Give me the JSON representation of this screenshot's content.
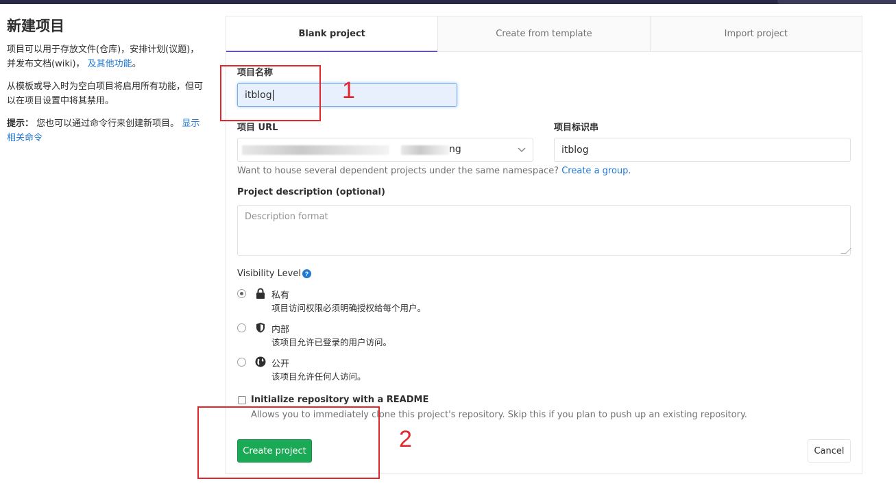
{
  "left": {
    "title": "新建项目",
    "desc": "项目可以用于存放文件(仓库)，安排计划(议题)，并发布文档(wiki)，",
    "desc_link": "及其他功能",
    "desc_end": "。",
    "template_note": "从模板或导入时为空白项目将启用所有功能，但可以在项目设置中将其禁用。",
    "tip_label": "提示：",
    "tip_text": "您也可以通过命令行来创建新项目。",
    "tip_link": "显示相关命令"
  },
  "tabs": [
    "Blank project",
    "Create from template",
    "Import project"
  ],
  "form": {
    "name_label": "项目名称",
    "name_value": "itblog",
    "url_label": "项目 URL",
    "namespace_partial": "ng",
    "slug_label": "项目标识串",
    "slug_value": "itblog",
    "group_help": "Want to house several dependent projects under the same namespace?",
    "group_link": "Create a group.",
    "desc_label": "Project description (optional)",
    "desc_placeholder": "Description format",
    "visibility_label": "Visibility Level",
    "visibility": [
      {
        "title": "私有",
        "desc": "项目访问权限必须明确授权给每个用户。",
        "icon": "lock-icon",
        "selected": true
      },
      {
        "title": "内部",
        "desc": "该项目允许已登录的用户访问。",
        "icon": "shield-icon",
        "selected": false
      },
      {
        "title": "公开",
        "desc": "该项目允许任何人访问。",
        "icon": "globe-icon",
        "selected": false
      }
    ],
    "readme_label": "Initialize repository with a README",
    "readme_help": "Allows you to immediately clone this project's repository. Skip this if you plan to push up an existing repository.",
    "create_button": "Create project",
    "cancel_button": "Cancel"
  },
  "annotations": [
    "1",
    "2"
  ],
  "colors": {
    "accent": "#6b4fbb",
    "link": "#1f78d1",
    "success": "#1aaa55",
    "annotation": "#e3262b"
  }
}
